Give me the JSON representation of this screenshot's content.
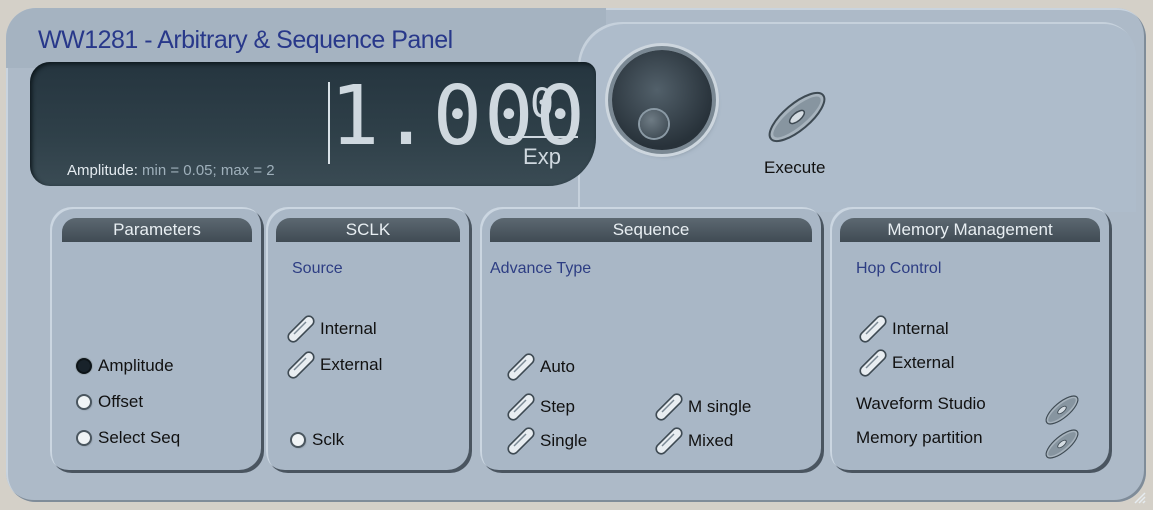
{
  "window": {
    "title": "WW1281 - Arbitrary & Sequence Panel"
  },
  "display": {
    "value": "1.000",
    "exponent_value": "0",
    "exponent_label": "Exp",
    "info_label": "Amplitude:",
    "info_range": " min = 0.05; max = 2"
  },
  "execute": {
    "label": "Execute"
  },
  "parameters": {
    "header": "Parameters",
    "options": [
      "Amplitude",
      "Offset",
      "Select Seq"
    ],
    "selected": "Amplitude"
  },
  "sclk": {
    "header": "SCLK",
    "subheader": "Source",
    "options": [
      "Internal",
      "External"
    ],
    "sclk_radio": "Sclk"
  },
  "sequence": {
    "header": "Sequence",
    "subheader": "Advance Type",
    "options_left": [
      "Auto",
      "Step",
      "Single"
    ],
    "options_right": [
      "M single",
      "Mixed"
    ]
  },
  "memory": {
    "header": "Memory Management",
    "subheader": "Hop Control",
    "options": [
      "Internal",
      "External"
    ],
    "buttons": [
      "Waveform Studio",
      "Memory partition"
    ]
  },
  "colors": {
    "panel_bg": "#adbac8",
    "title_text": "#28388a",
    "group_header": "#4a5660",
    "display_bg": "#2f4049"
  }
}
